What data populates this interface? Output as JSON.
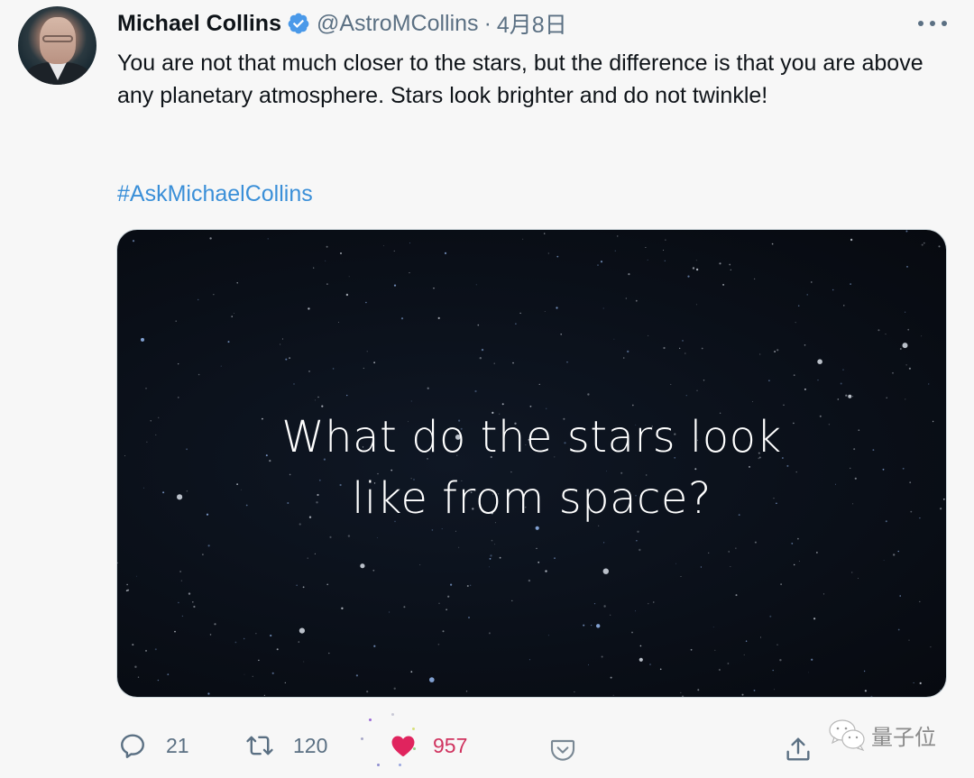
{
  "tweet": {
    "author": {
      "display_name": "Michael Collins",
      "handle": "@AstroMCollins",
      "verified": true,
      "avatar_icon": "profile-photo"
    },
    "separator": "·",
    "date": "4月8日",
    "more_icon": "more-horizontal-icon",
    "text": "You are not that much closer to the stars, but the difference is that you are above any planetary atmosphere. Stars look brighter and do not twinkle!",
    "hashtag": "#AskMichaelCollins",
    "media": {
      "caption_line1": "What do the stars look",
      "caption_line2": "like from space?"
    },
    "actions": {
      "reply": {
        "icon": "reply-icon",
        "count": "21"
      },
      "retweet": {
        "icon": "retweet-icon",
        "count": "120"
      },
      "like": {
        "icon": "heart-icon",
        "count": "957",
        "liked": true
      },
      "pocket": {
        "icon": "pocket-save-icon"
      },
      "share": {
        "icon": "share-icon"
      }
    }
  },
  "colors": {
    "background": "#f7f7f7",
    "text_primary": "#0f1419",
    "text_secondary": "#5b7083",
    "link": "#3a8fd8",
    "verified": "#4a99e9",
    "liked": "#e0245e"
  },
  "watermark": {
    "icon": "wechat-icon",
    "text": "量子位"
  }
}
